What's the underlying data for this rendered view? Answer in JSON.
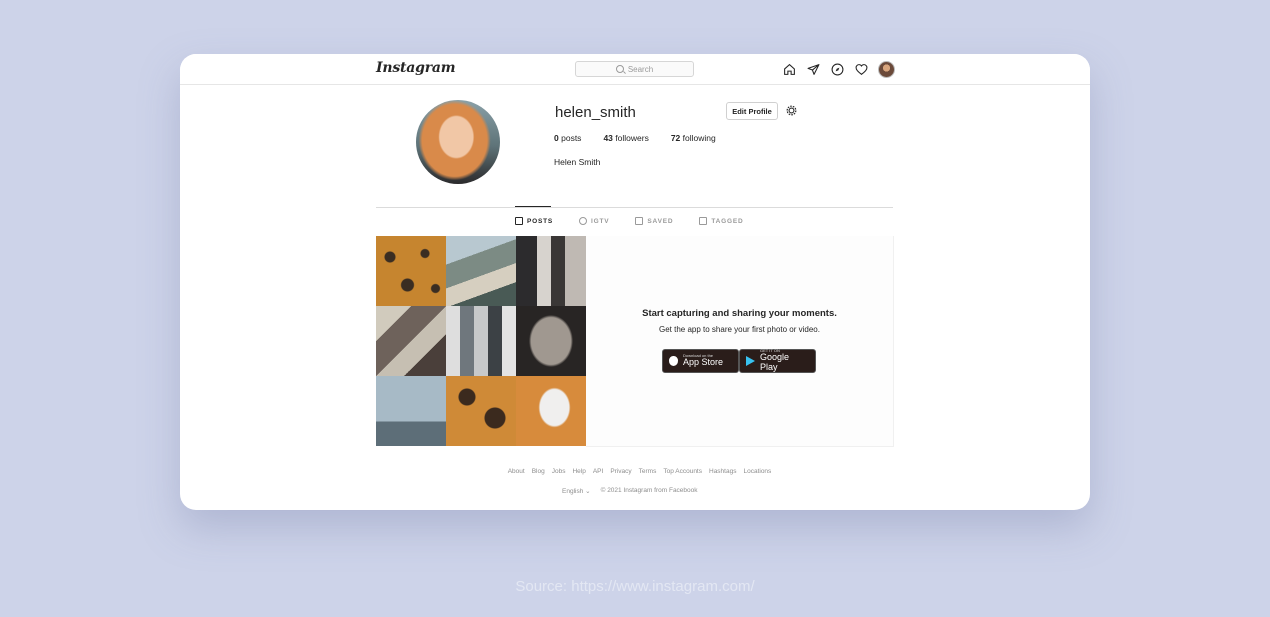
{
  "topbar": {
    "logo": "Instagram",
    "search_placeholder": "Search",
    "icons": [
      "home-icon",
      "direct-icon",
      "explore-icon",
      "heart-icon",
      "profile-avatar"
    ]
  },
  "profile": {
    "username": "helen_smith",
    "edit_button": "Edit Profile",
    "stats": {
      "posts_count": "0",
      "posts_label": "posts",
      "followers_count": "43",
      "followers_label": "followers",
      "following_count": "72",
      "following_label": "following"
    },
    "full_name": "Helen Smith"
  },
  "tabs": [
    {
      "label": "POSTS",
      "active": true
    },
    {
      "label": "IGTV",
      "active": false
    },
    {
      "label": "SAVED",
      "active": false
    },
    {
      "label": "TAGGED",
      "active": false
    }
  ],
  "empty_state": {
    "title": "Start capturing and sharing your moments.",
    "subtitle": "Get the app to share your first photo or video.",
    "app_store": {
      "small": "Download on the",
      "big": "App Store"
    },
    "google_play": {
      "small": "GET IT ON",
      "big": "Google Play"
    }
  },
  "footer": {
    "links": [
      "About",
      "Blog",
      "Jobs",
      "Help",
      "API",
      "Privacy",
      "Terms",
      "Top Accounts",
      "Hashtags",
      "Locations"
    ],
    "language": "English",
    "copyright": "© 2021 Instagram from Facebook"
  },
  "source_caption": "Source: https://www.instagram.com/",
  "colors": {
    "background": "#cdd3e9",
    "card": "#ffffff",
    "text": "#262626",
    "muted": "#8e8e8e"
  }
}
